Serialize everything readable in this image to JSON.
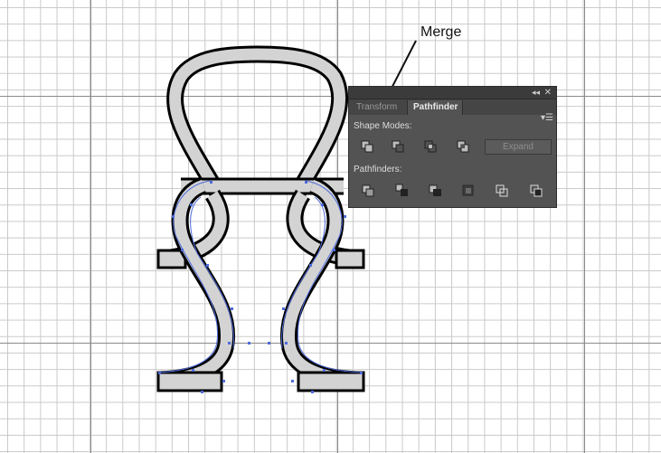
{
  "callout": {
    "label": "Merge"
  },
  "panel": {
    "collapse_icon": "collapse-arrows-icon",
    "close_icon": "close-icon",
    "tabs": [
      {
        "label": "Transform",
        "active": false
      },
      {
        "label": "Pathfinder",
        "active": true
      }
    ],
    "menu_icon": "panel-menu-icon",
    "shape_modes_label": "Shape Modes:",
    "shape_modes": [
      {
        "name": "unite"
      },
      {
        "name": "minus-front"
      },
      {
        "name": "intersect"
      },
      {
        "name": "exclude"
      }
    ],
    "expand_label": "Expand",
    "pathfinders_label": "Pathfinders:",
    "pathfinders": [
      {
        "name": "divide"
      },
      {
        "name": "trim"
      },
      {
        "name": "merge"
      },
      {
        "name": "crop"
      },
      {
        "name": "outline"
      },
      {
        "name": "minus-back"
      }
    ]
  },
  "colors": {
    "shape_fill": "#d3d3d3",
    "shape_stroke": "#000000",
    "selection": "#4d6bdc",
    "panel_bg": "#535353"
  }
}
